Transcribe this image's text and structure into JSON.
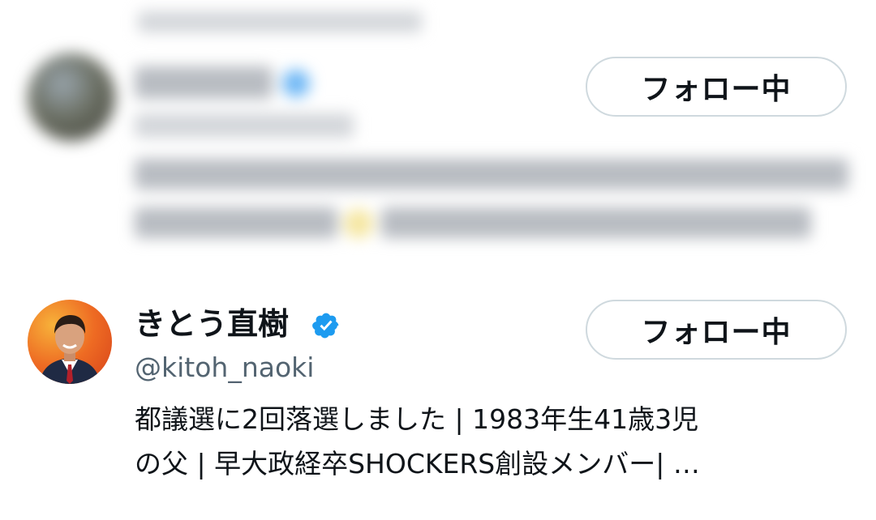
{
  "blurred_user": {
    "follow_label": "フォロー中"
  },
  "user": {
    "display_name": "きとう直樹",
    "handle": "@kitoh_naoki",
    "verified_icon": "verified-badge-icon",
    "follow_label": "フォロー中",
    "bio_lines": [
      "都議選に2回落選しました | 1983年生41歳3児",
      "の父 | 早大政経卒SHOCKERS創設メンバー| …"
    ]
  },
  "colors": {
    "text_primary": "#0f1419",
    "text_secondary": "#536471",
    "button_border": "#cfd9de",
    "verified_blue": "#1d9bf0"
  }
}
